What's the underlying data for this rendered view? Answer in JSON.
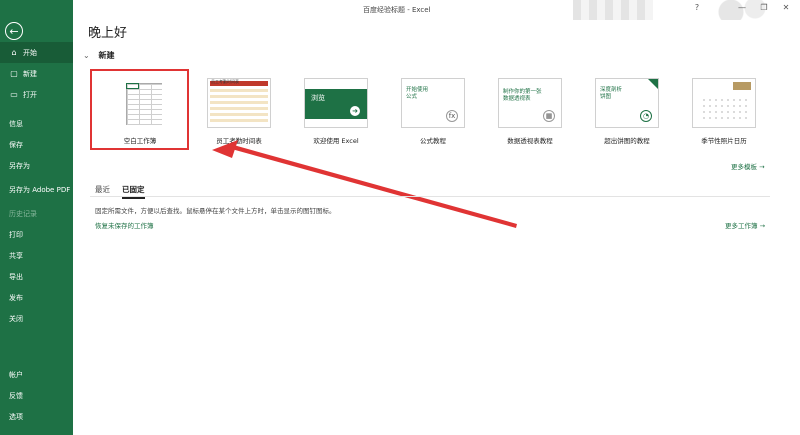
{
  "titlebar": {
    "title": "百度经验标题 - Excel",
    "help": "?",
    "minimize": "—",
    "restore": "❐",
    "close": "✕"
  },
  "sidebar": {
    "back": "←",
    "top_items": [
      {
        "label": "开始",
        "icon": "⌂"
      },
      {
        "label": "新建",
        "icon": "▢"
      },
      {
        "label": "打开",
        "icon": "▭"
      }
    ],
    "mid_items": [
      {
        "label": "信息"
      },
      {
        "label": "保存"
      },
      {
        "label": "另存为"
      },
      {
        "label": "另存为 Adobe PDF"
      },
      {
        "label": "历史记录"
      },
      {
        "label": "打印"
      },
      {
        "label": "共享"
      },
      {
        "label": "导出"
      },
      {
        "label": "发布"
      },
      {
        "label": "关闭"
      }
    ],
    "bottom_items": [
      {
        "label": "帐户"
      },
      {
        "label": "反馈"
      },
      {
        "label": "选项"
      }
    ]
  },
  "main": {
    "greeting": "晚上好",
    "new_section": {
      "chevron": "⌄",
      "label": "新建"
    },
    "templates": [
      {
        "label": "空白工作簿"
      },
      {
        "label": "员工考勤时间表",
        "thumb_title": "员工考勤时间表"
      },
      {
        "label": "欢迎使用 Excel",
        "thumb_text": "浏览"
      },
      {
        "label": "公式教程",
        "thumb_text": "开始使用\n公式"
      },
      {
        "label": "数据透视表教程",
        "thumb_text": "制作你的第一张\n数据透视表"
      },
      {
        "label": "超出饼图的教程",
        "thumb_text": "深度剖析\n饼图"
      },
      {
        "label": "季节性照片日历"
      }
    ],
    "more_templates": "更多模板  →",
    "tabs": [
      {
        "label": "最近"
      },
      {
        "label": "已固定"
      }
    ],
    "pin_hint": "固定所需文件，方便以后查找。鼠标悬停在某个文件上方时，单击显示的图钉图标。",
    "recover_link": "恢复未保存的工作簿",
    "more_workbooks": "更多工作簿  →"
  },
  "colors": {
    "accent": "#1e7145",
    "sidebar_active": "#185c37",
    "highlight": "#e03434"
  }
}
